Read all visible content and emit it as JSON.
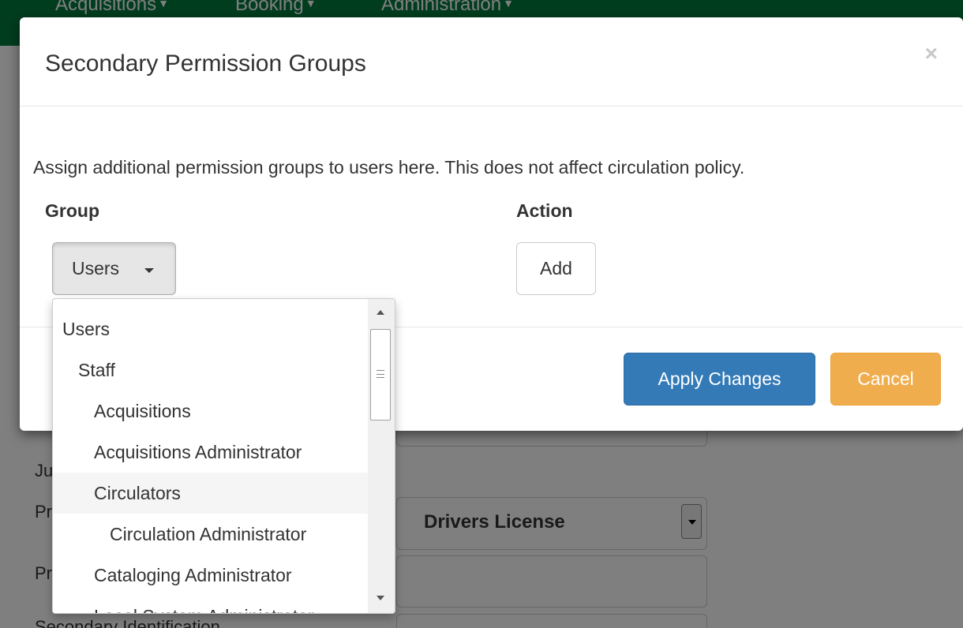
{
  "background": {
    "navbar": {
      "items": [
        "Acquisitions",
        "Booking",
        "Administration"
      ]
    },
    "fields": {
      "partial_label_1": "Ju",
      "partial_label_2": "Pr",
      "partial_label_3": "Pr",
      "secondary_identification_label": "Secondary Identification",
      "primary_id_type_value": "Drivers License"
    }
  },
  "modal": {
    "title": "Secondary Permission Groups",
    "close_glyph": "×",
    "description": "Assign additional permission groups to users here. This does not affect circulation policy.",
    "columns": {
      "group": "Group",
      "action": "Action"
    },
    "group_select": {
      "selected": "Users"
    },
    "add_label": "Add",
    "apply_label": "Apply Changes",
    "cancel_label": "Cancel"
  },
  "dropdown": {
    "items": [
      {
        "label": "Users",
        "depth": 0,
        "highlighted": false
      },
      {
        "label": "Staff",
        "depth": 1,
        "highlighted": false
      },
      {
        "label": "Acquisitions",
        "depth": 2,
        "highlighted": false
      },
      {
        "label": "Acquisitions Administrator",
        "depth": 2,
        "highlighted": false
      },
      {
        "label": "Circulators",
        "depth": 2,
        "highlighted": true
      },
      {
        "label": "Circulation Administrator",
        "depth": 3,
        "highlighted": false
      },
      {
        "label": "Cataloging Administrator",
        "depth": 2,
        "highlighted": false
      },
      {
        "label": "Local System Administrator",
        "depth": 2,
        "highlighted": false
      }
    ]
  },
  "colors": {
    "navbar": "#007a3d",
    "primary_button": "#337ab7",
    "warning_button": "#f0ad4e",
    "highlight_row": "#f5f5f5"
  }
}
